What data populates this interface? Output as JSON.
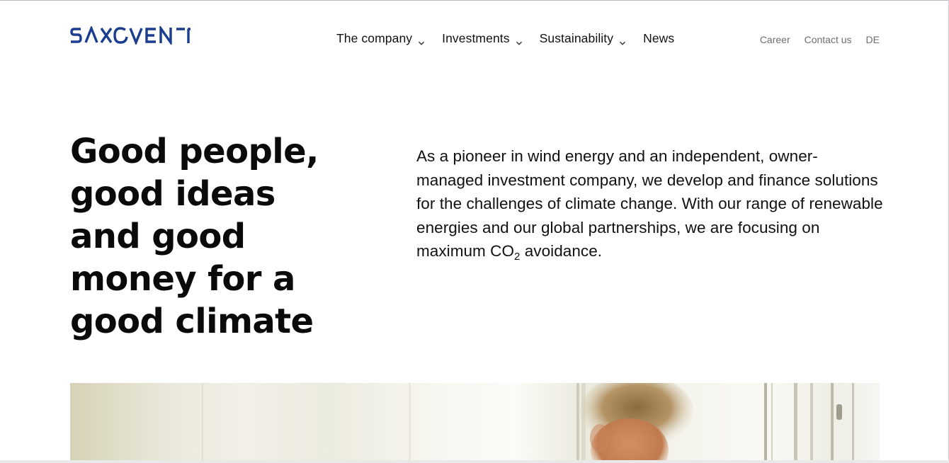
{
  "header": {
    "logo_text": "SAXOVENT",
    "nav": [
      {
        "label": "The company",
        "has_dropdown": true
      },
      {
        "label": "Investments",
        "has_dropdown": true
      },
      {
        "label": "Sustainability",
        "has_dropdown": true
      },
      {
        "label": "News",
        "has_dropdown": false
      }
    ],
    "meta": {
      "career": "Career",
      "contact": "Contact us",
      "language": "DE"
    }
  },
  "hero": {
    "headline_lines": [
      "Good people,",
      "good ideas",
      "and good",
      "money for a",
      "good climate"
    ],
    "intro_main": "As a pioneer in wind energy and an independent, owner-managed investment company, we develop and finance solutions for the challenges of climate change. With our range of renewable energies and our global partnerships, we are focusing on maximum CO",
    "intro_sub": "2",
    "intro_end": " avoidance."
  },
  "colors": {
    "brand_blue": "#1a3d8f",
    "text": "#111111",
    "muted": "#6e6e6e"
  },
  "icons": {
    "dropdown": "chevron-down-icon"
  }
}
